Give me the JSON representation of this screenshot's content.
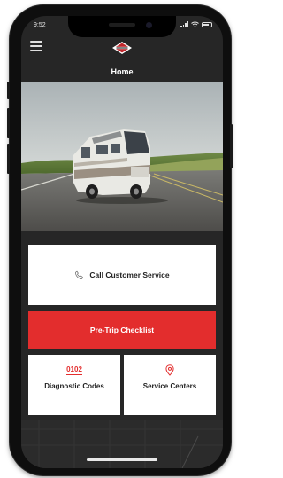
{
  "status_bar": {
    "time": "9:52"
  },
  "header": {
    "title": "Home"
  },
  "actions": {
    "call_customer_service": "Call Customer Service",
    "pre_trip_checklist": "Pre-Trip Checklist"
  },
  "tiles": [
    {
      "top_text": "0102",
      "label": "Diagnostic Codes",
      "icon": ""
    },
    {
      "top_text": "",
      "label": "Service Centers",
      "icon": "map-pin-icon"
    }
  ],
  "colors": {
    "accent_red": "#e32d2d",
    "background_dark": "#262626",
    "card_white": "#ffffff"
  }
}
